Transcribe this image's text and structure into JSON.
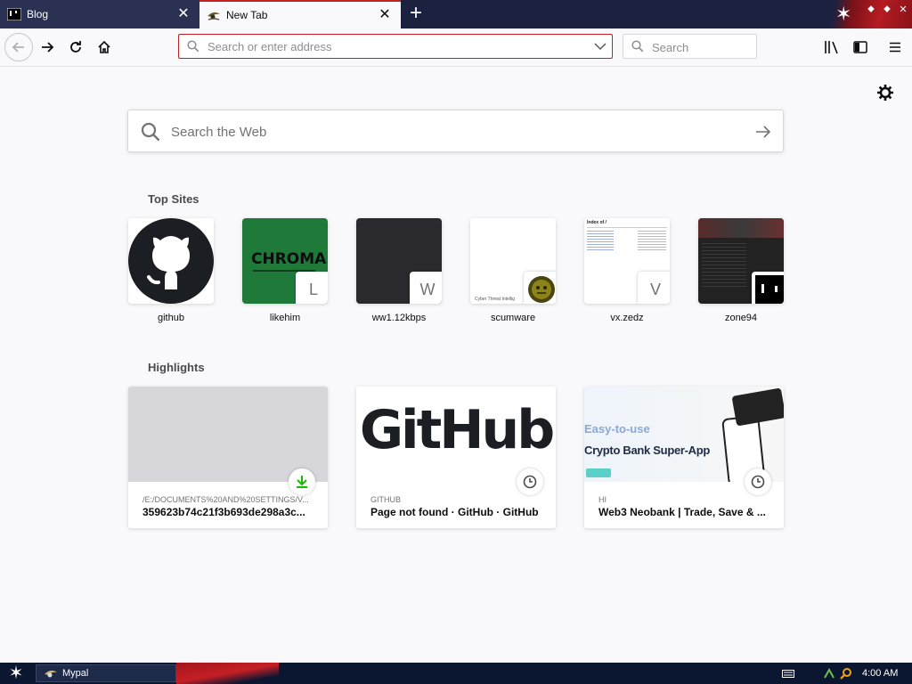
{
  "tabs": [
    {
      "title": "Blog",
      "active": false
    },
    {
      "title": "New Tab",
      "active": true
    }
  ],
  "colors": {
    "accent_red": "#c4211f",
    "tabstrip": "#1c2140",
    "taskbar": "#0b1630"
  },
  "toolbar": {
    "url_placeholder": "Search or enter address",
    "search_placeholder": "Search"
  },
  "newtab": {
    "web_search_placeholder": "Search the Web",
    "top_sites_title": "Top Sites",
    "highlights_title": "Highlights",
    "top_sites": [
      {
        "label": "github",
        "badge": ""
      },
      {
        "label": "likehim",
        "badge": "L",
        "thumb_text": "CHROMAK"
      },
      {
        "label": "ww1.12kbps",
        "badge": "W"
      },
      {
        "label": "scumware",
        "badge": "",
        "thumb_text": "Cyber Threat Intellig"
      },
      {
        "label": "vx.zedz",
        "badge": "V",
        "thumb_text": "Index of /"
      },
      {
        "label": "zone94",
        "badge": ""
      }
    ],
    "highlights": [
      {
        "context": "/E:/DOCUMENTS%20AND%20SETTINGS/V...",
        "title": "359623b74c21f3b693de298a3c...",
        "icon": "download-icon"
      },
      {
        "context": "GITHUB",
        "title": "Page not found · GitHub · GitHub",
        "icon": "clock-icon",
        "image_text": "GitHub"
      },
      {
        "context": "HI",
        "title": "Web3 Neobank | Trade, Save & ...",
        "icon": "clock-icon",
        "image_text_1": "Easy-to-use",
        "image_text_2": "Crypto Bank Super-App"
      }
    ]
  },
  "taskbar": {
    "window_label": "Mypal",
    "clock": "4:00 AM"
  }
}
